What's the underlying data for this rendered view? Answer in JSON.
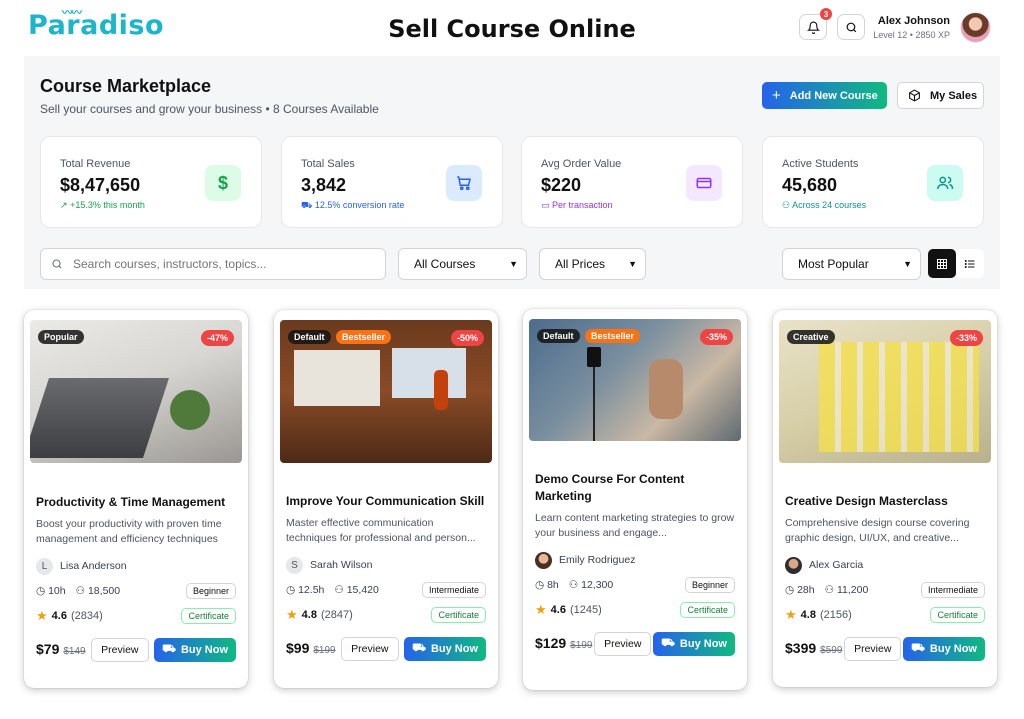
{
  "brand": {
    "logo_text": "Paradiso",
    "accent": "#1cb5c9"
  },
  "header": {
    "page_title": "Sell Course Online",
    "notification_count": "3",
    "user_name": "Alex Johnson",
    "user_level": "Level 12 • 2850 XP"
  },
  "marketplace": {
    "title": "Course Marketplace",
    "subtitle": "Sell your courses and grow your business • 8 Courses Available",
    "add_button": "Add New Course",
    "sales_button": "My Sales"
  },
  "stats": [
    {
      "label": "Total Revenue",
      "value": "$8,47,650",
      "note": "+15.3% this month",
      "icon": "dollar-icon",
      "color": "#16a34a"
    },
    {
      "label": "Total Sales",
      "value": "3,842",
      "note": "12.5% conversion rate",
      "icon": "cart-icon",
      "color": "#2563eb"
    },
    {
      "label": "Avg Order Value",
      "value": "$220",
      "note": "Per transaction",
      "icon": "card-icon",
      "color": "#9333ea"
    },
    {
      "label": "Active Students",
      "value": "45,680",
      "note": "Across 24 courses",
      "icon": "users-icon",
      "color": "#0d9488"
    }
  ],
  "filters": {
    "search_placeholder": "Search courses, instructors, topics...",
    "category_selected": "All Courses",
    "price_selected": "All Prices",
    "sort_selected": "Most Popular",
    "view_mode": "grid"
  },
  "courses": [
    {
      "tag1": "Popular",
      "tag2": "",
      "discount": "-47%",
      "title": "Productivity & Time Management",
      "desc": "Boost your productivity with proven time management and efficiency techniques",
      "instructor_initial": "L",
      "instructor": "Lisa Anderson",
      "duration": "10h",
      "students": "18,500",
      "level": "Beginner",
      "rating": "4.6",
      "reviews": "(2834)",
      "cert": "Certificate",
      "price": "$79",
      "old_price": "$149",
      "preview": "Preview",
      "buy": "Buy Now"
    },
    {
      "tag1": "Default",
      "tag2": "Bestseller",
      "discount": "-50%",
      "title": "Improve Your Communication Skill",
      "desc": "Master effective communication techniques for professional and person...",
      "instructor_initial": "S",
      "instructor": "Sarah Wilson",
      "duration": "12.5h",
      "students": "15,420",
      "level": "Intermediate",
      "rating": "4.8",
      "reviews": "(2847)",
      "cert": "Certificate",
      "price": "$99",
      "old_price": "$199",
      "preview": "Preview",
      "buy": "Buy Now"
    },
    {
      "tag1": "Default",
      "tag2": "Bestseller",
      "discount": "-35%",
      "title": "Demo Course For Content Marketing",
      "desc": "Learn content marketing strategies to grow your business and engage...",
      "instructor_initial": "",
      "instructor": "Emily Rodriguez",
      "duration": "8h",
      "students": "12,300",
      "level": "Beginner",
      "rating": "4.6",
      "reviews": "(1245)",
      "cert": "Certificate",
      "price": "$129",
      "old_price": "$199",
      "preview": "Preview",
      "buy": "Buy Now"
    },
    {
      "tag1": "Creative",
      "tag2": "",
      "discount": "-33%",
      "title": "Creative Design Masterclass",
      "desc": "Comprehensive design course covering graphic design, UI/UX, and creative...",
      "instructor_initial": "",
      "instructor": "Alex Garcia",
      "duration": "28h",
      "students": "11,200",
      "level": "Intermediate",
      "rating": "4.8",
      "reviews": "(2156)",
      "cert": "Certificate",
      "price": "$399",
      "old_price": "$599",
      "preview": "Preview",
      "buy": "Buy Now"
    }
  ]
}
